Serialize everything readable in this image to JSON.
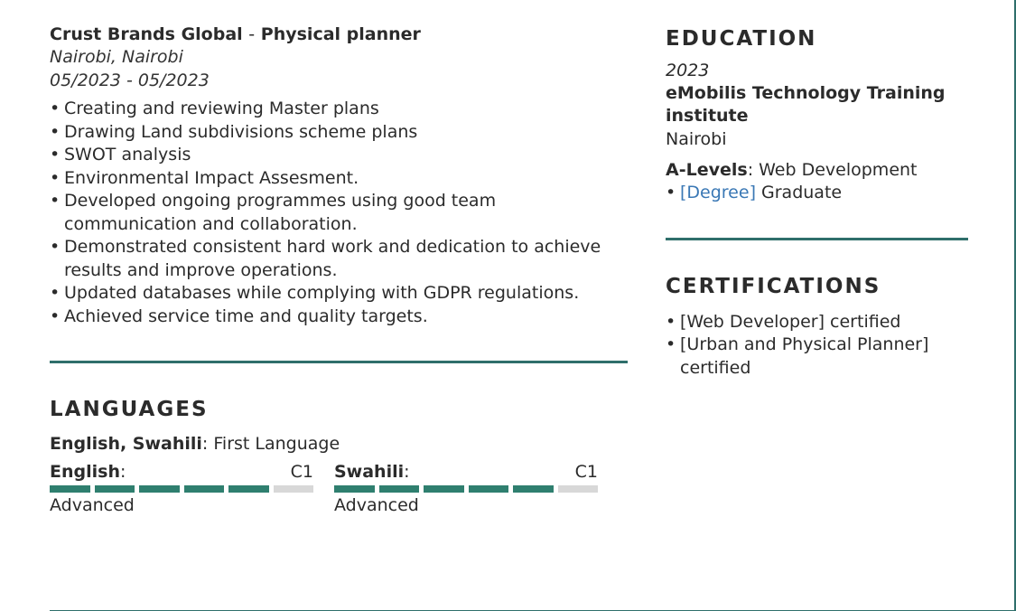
{
  "experience": {
    "company": "Crust Brands Global",
    "separator": "-",
    "role": "Physical planner",
    "location": "Nairobi, Nairobi",
    "dates": "05/2023 - 05/2023",
    "bullets": [
      "Creating and reviewing Master plans",
      "Drawing Land subdivisions scheme plans",
      "SWOT analysis",
      "Environmental Impact Assesment.",
      "Developed ongoing programmes using good team communication and collaboration.",
      "Demonstrated consistent hard work and dedication to achieve results and improve operations.",
      "Updated databases while complying with GDPR regulations.",
      "Achieved service time and quality targets."
    ]
  },
  "languages": {
    "heading": "LANGUAGES",
    "first_language_names": "English, Swahili",
    "first_language_label": ": First Language",
    "items": [
      {
        "name": "English",
        "colon": ":",
        "level": "C1",
        "description": "Advanced",
        "filled": 5,
        "total": 6
      },
      {
        "name": "Swahili",
        "colon": ":",
        "level": "C1",
        "description": "Advanced",
        "filled": 5,
        "total": 6
      }
    ]
  },
  "education": {
    "heading": "EDUCATION",
    "year": "2023",
    "school": "eMobilis Technology Training institute",
    "location": "Nairobi",
    "degree_level": "A-Levels",
    "degree_field": ": Web Development",
    "degree_link": "[Degree]",
    "degree_suffix": " Graduate"
  },
  "certifications": {
    "heading": "CERTIFICATIONS",
    "items": [
      "[Web Developer] certified",
      "[Urban and Physical Planner] certified"
    ]
  },
  "colors": {
    "accent": "#2f6f6b",
    "bar_filled": "#2f7f6f",
    "bar_empty": "#d8d8d8",
    "link": "#3a78b5"
  }
}
